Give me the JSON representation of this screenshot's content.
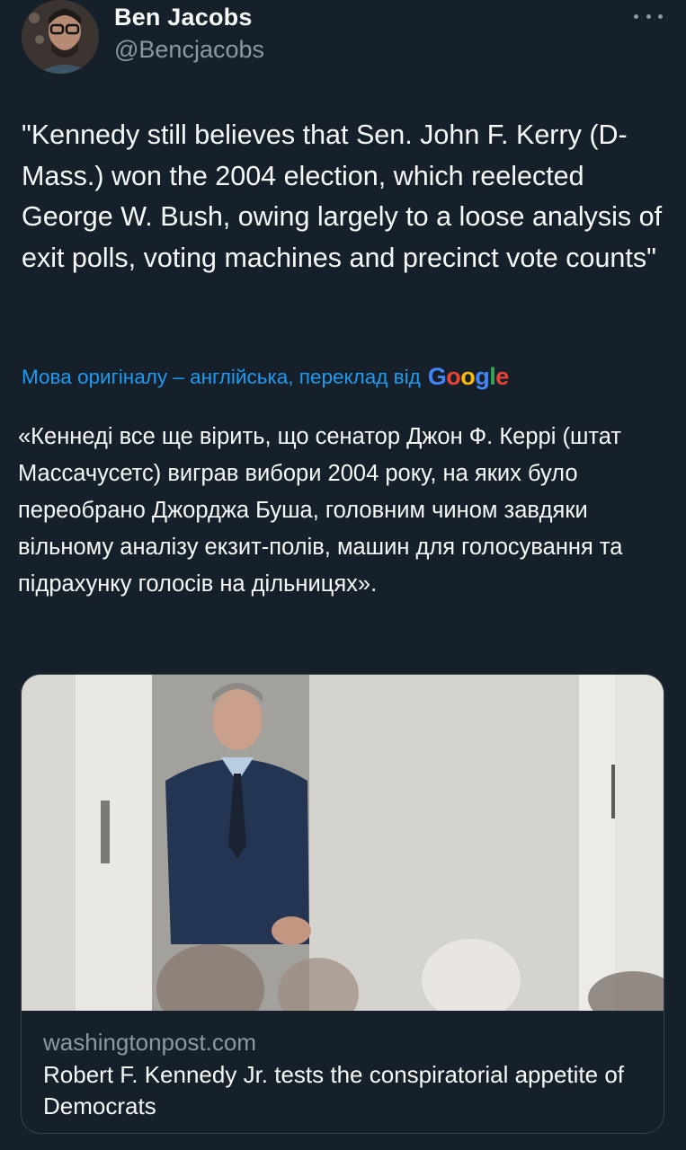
{
  "author": {
    "name": "Ben Jacobs",
    "handle": "@Bencjacobs"
  },
  "tweet": {
    "text": "\"Kennedy still believes that Sen. John F. Kerry (D-Mass.) won the 2004 election, which reelected George W. Bush, owing largely to a loose analysis of exit polls, voting machines and precinct vote counts\"",
    "translation_note": "Мова оригіналу – англійська, переклад від",
    "translation_provider": "Google",
    "translated_text": "«Кеннеді все ще вірить, що сенатор Джон Ф. Керрі (штат Массачусетс) виграв вибори 2004 року, на яких було переобрано Джорджа Буша, головним чином завдяки вільному аналізу екзит-полів, машин для голосування та підрахунку голосів на дільницях»."
  },
  "link_card": {
    "domain": "washingtonpost.com",
    "title": "Robert F. Kennedy Jr. tests the conspiratorial appetite of Democrats"
  },
  "icons": {
    "more": "more-horizontal-icon"
  },
  "colors": {
    "background": "#15202b",
    "text": "#f7f9f9",
    "secondary_text": "#8b98a5",
    "link": "#1d9bf0",
    "border": "#38444d"
  }
}
